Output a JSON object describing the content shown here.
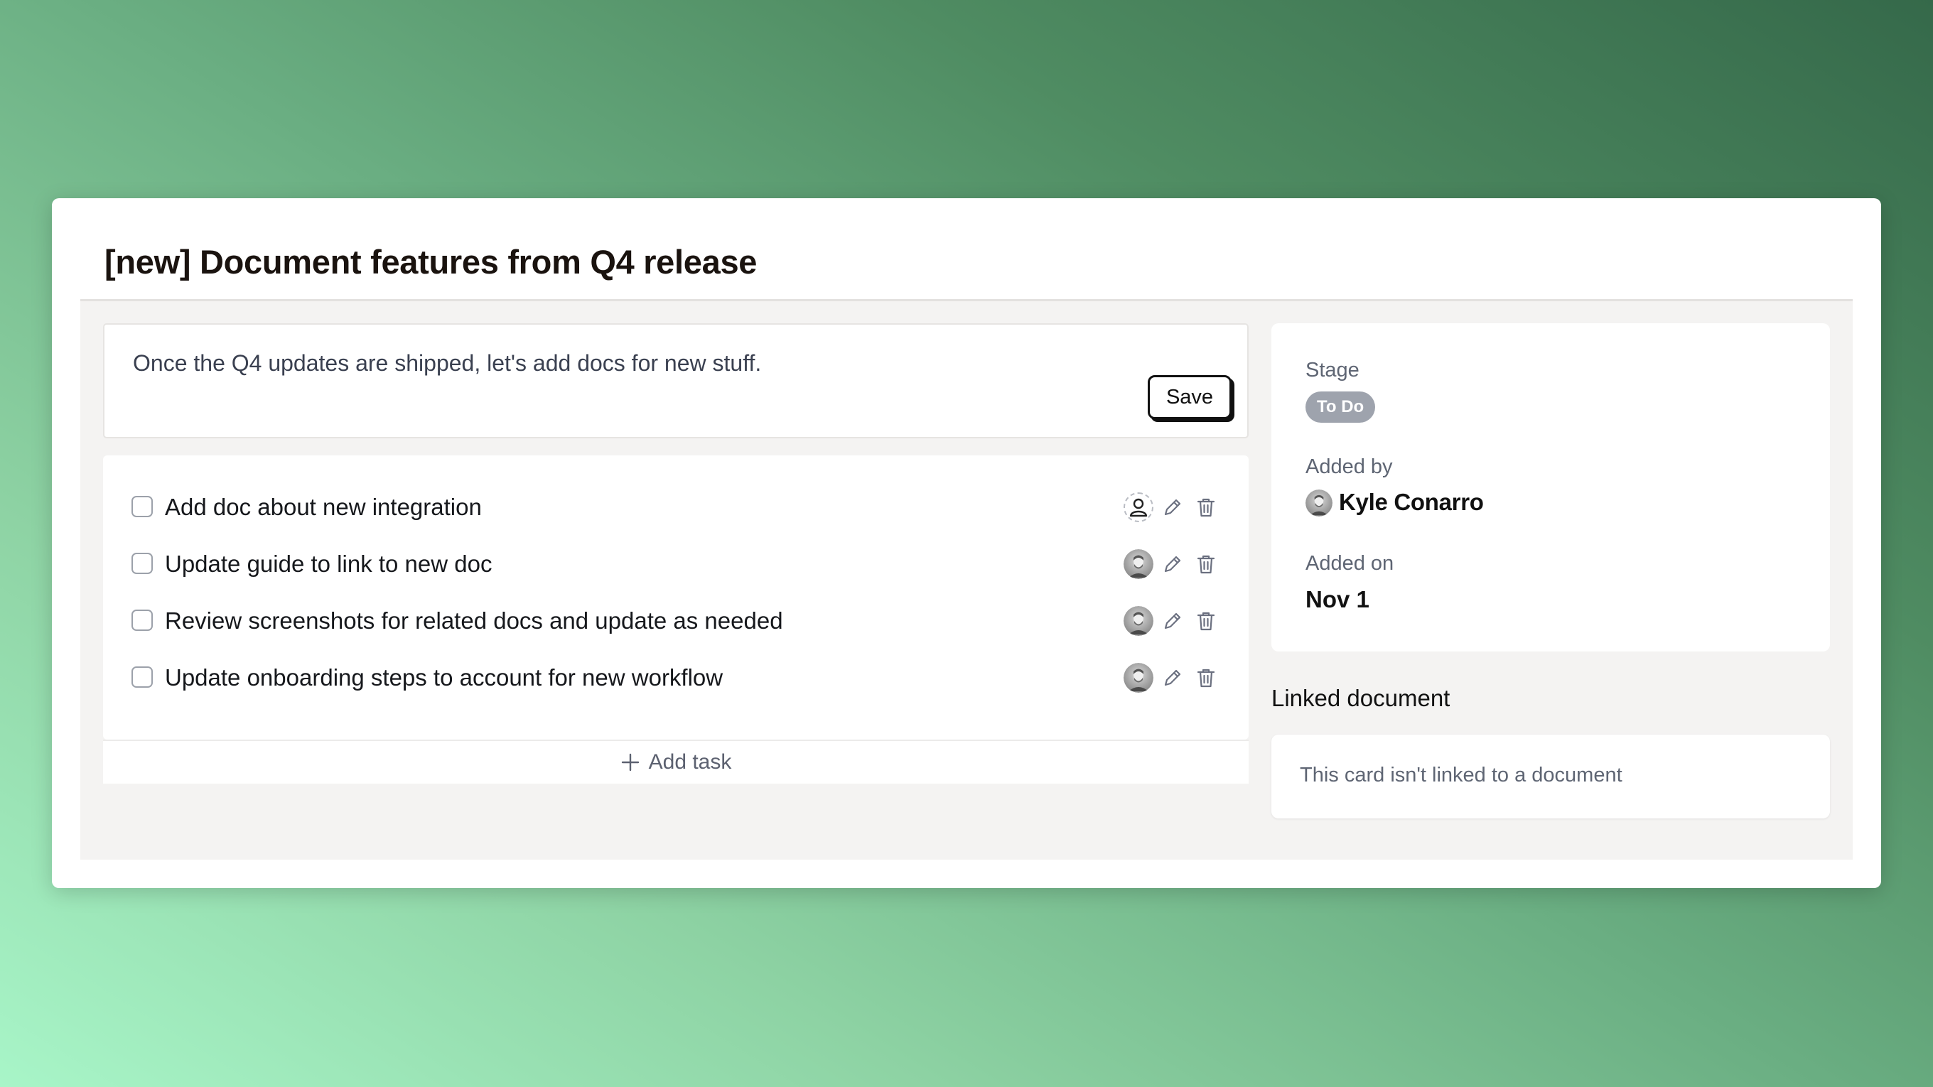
{
  "card": {
    "title": "[new] Document features from Q4 release",
    "description": "Once the Q4 updates are shipped, let's add docs for new stuff.",
    "save_label": "Save"
  },
  "tasks": [
    {
      "label": "Add doc about new integration",
      "assignee": "unassigned-icon",
      "done": false
    },
    {
      "label": "Update guide to link to new doc",
      "assignee": "avatar",
      "done": false
    },
    {
      "label": "Review screenshots for related docs and update as needed",
      "assignee": "avatar",
      "done": false
    },
    {
      "label": "Update onboarding steps to account for new workflow",
      "assignee": "avatar",
      "done": false
    }
  ],
  "add_task_label": "Add task",
  "meta": {
    "stage_label": "Stage",
    "stage_value": "To Do",
    "added_by_label": "Added by",
    "added_by_name": "Kyle Conarro",
    "added_on_label": "Added on",
    "added_on_value": "Nov 1"
  },
  "linked": {
    "heading": "Linked document",
    "empty_text": "This card isn't linked to a document"
  },
  "icons": {
    "edit": "pencil-icon",
    "delete": "trash-icon",
    "add": "plus-icon",
    "unassigned": "user-icon"
  },
  "colors": {
    "badge": "#9ea3ad",
    "text_primary": "#111111",
    "text_muted": "#5e6573"
  }
}
